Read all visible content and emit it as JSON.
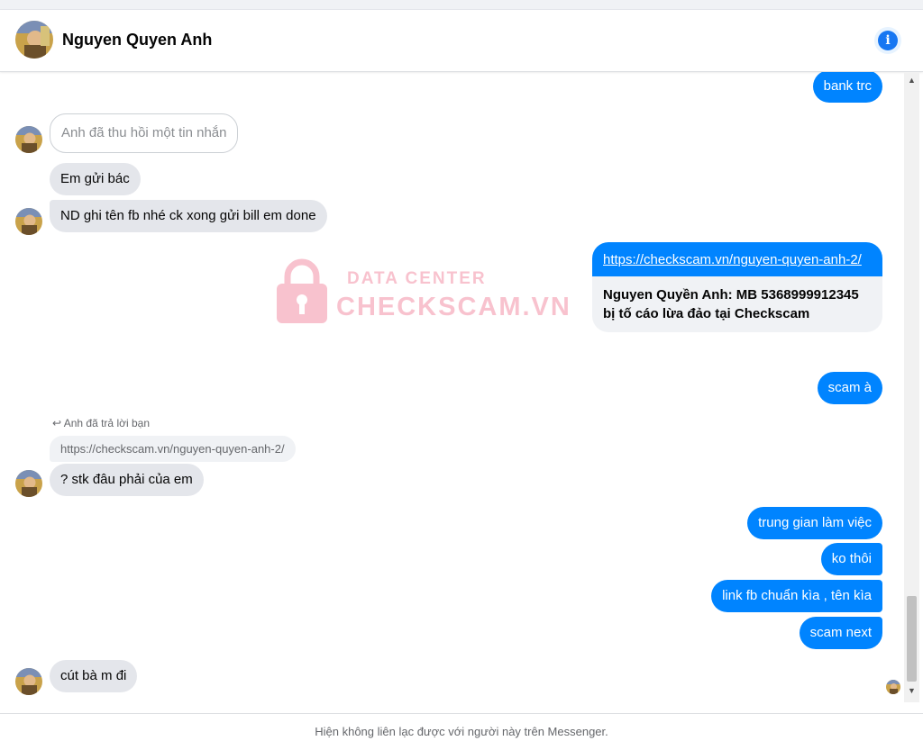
{
  "header": {
    "contact_name": "Nguyen Quyen Anh",
    "info_icon": "info-circle-icon"
  },
  "messages": {
    "m1": "bank trc",
    "m2": "Anh đã thu hồi một tin nhắn",
    "m3": "Em gửi bác",
    "m4": "ND ghi tên fb nhé ck xong gửi bill em done",
    "link_url": "https://checkscam.vn/nguyen-quyen-anh-2/",
    "link_desc": "Nguyen Quyền Anh: MB 5368999912345 bị tố cáo lừa đảo tại Checkscam",
    "m5": "scam à",
    "reply_note": "Anh đã trả lời bạn",
    "reply_quote": "https://checkscam.vn/nguyen-quyen-anh-2/",
    "m6": "? stk đâu phải của em",
    "m7": "trung gian làm việc",
    "m8": "ko thôi",
    "m9": "link fb chuẩn kìa , tên kìa",
    "m10": "scam next",
    "m11": "cút bà m đi"
  },
  "watermark": {
    "line1": "DATA CENTER",
    "line2": "CHECKSCAM.VN"
  },
  "footer": {
    "notice": "Hiện không liên lạc được với người này trên Messenger."
  },
  "colors": {
    "outgoing": "#0084ff",
    "incoming": "#e4e6eb",
    "accent": "#1877f2"
  }
}
